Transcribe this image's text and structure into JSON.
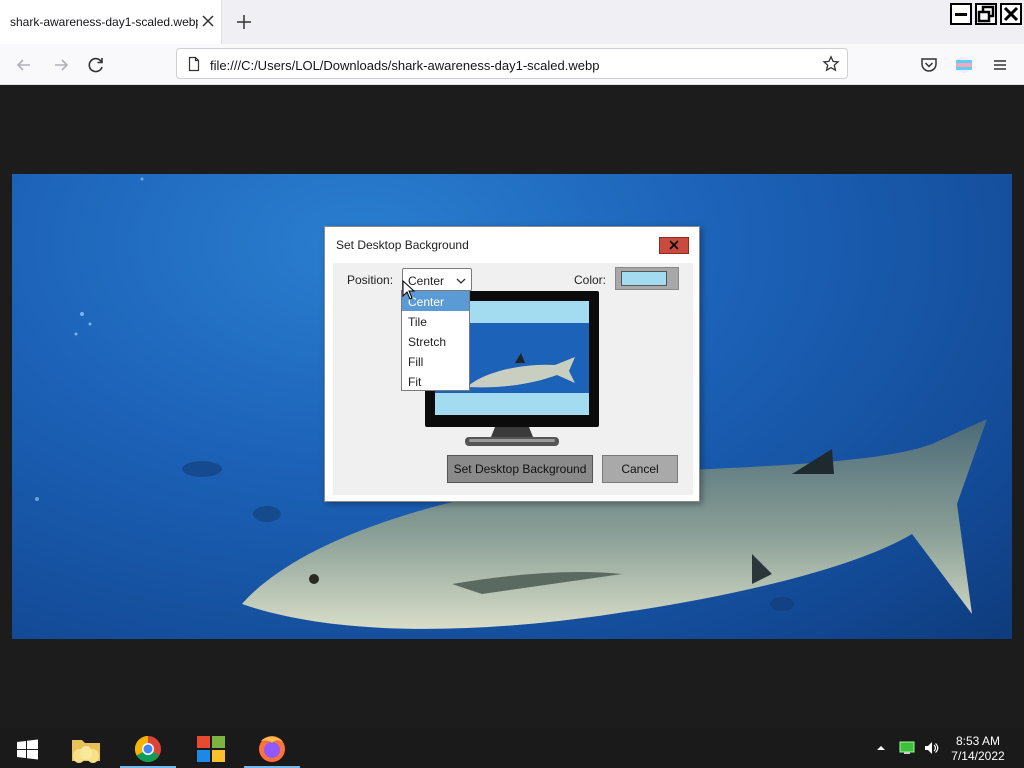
{
  "browser": {
    "tab_title": "shark-awareness-day1-scaled.webp",
    "url": "file:///C:/Users/LOL/Downloads/shark-awareness-day1-scaled.webp"
  },
  "dialog": {
    "title": "Set Desktop Background",
    "position_label": "Position:",
    "position_value": "Center",
    "color_label": "Color:",
    "color_value": "#a3dcf0",
    "position_options": [
      "Center",
      "Tile",
      "Stretch",
      "Fill",
      "Fit"
    ],
    "selected_option": "Center",
    "set_button": "Set Desktop Background",
    "cancel_button": "Cancel"
  },
  "taskbar": {
    "apps": [
      "start-icon",
      "file-explorer-icon",
      "chrome-icon",
      "office-icon",
      "firefox-icon"
    ],
    "clock_time": "8:53 AM",
    "clock_date": "7/14/2022"
  },
  "colors": {
    "accent": "#5b9bd5",
    "dialog_close": "#c94a3e",
    "taskbar": "#1a1a1a"
  }
}
